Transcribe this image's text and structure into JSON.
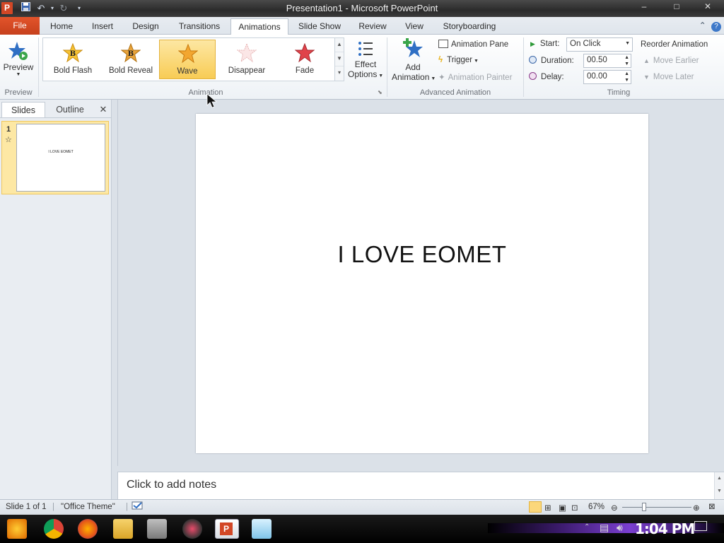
{
  "window": {
    "title": "Presentation1 - Microsoft PowerPoint",
    "app_icon_letter": "P",
    "min": "–",
    "max": "□",
    "close": "✕"
  },
  "ribbon_tabs": [
    "File",
    "Home",
    "Insert",
    "Design",
    "Transitions",
    "Animations",
    "Slide Show",
    "Review",
    "View",
    "Storyboarding"
  ],
  "active_tab": "Animations",
  "ribbon": {
    "preview": {
      "label": "Preview",
      "group": "Preview"
    },
    "animation_gallery": [
      {
        "label": "Bold Flash",
        "color": "#f5c232"
      },
      {
        "label": "Bold Reveal",
        "color": "#e8a33a"
      },
      {
        "label": "Wave",
        "color": "#f2a630",
        "selected": true
      },
      {
        "label": "Disappear",
        "color": "#f2c6c6"
      },
      {
        "label": "Fade",
        "color": "#e0434a"
      }
    ],
    "effect_options": {
      "line1": "Effect",
      "line2": "Options"
    },
    "animation_group_label": "Animation",
    "add_animation": {
      "line1": "Add",
      "line2": "Animation"
    },
    "animation_pane": "Animation Pane",
    "trigger": "Trigger",
    "animation_painter": "Animation Painter",
    "advanced_group_label": "Advanced Animation",
    "timing": {
      "start_label": "Start:",
      "start_value": "On Click",
      "duration_label": "Duration:",
      "duration_value": "00.50",
      "delay_label": "Delay:",
      "delay_value": "00.00",
      "group_label": "Timing"
    },
    "reorder": {
      "title": "Reorder Animation",
      "earlier": "Move Earlier",
      "later": "Move Later"
    }
  },
  "left_pane": {
    "tabs": [
      "Slides",
      "Outline"
    ],
    "active": "Slides",
    "close": "✕",
    "slide_number": "1",
    "anim_marker": "☆",
    "thumb_text": "I LOVE EOMET"
  },
  "slide": {
    "text": "I LOVE EOMET"
  },
  "notes": {
    "placeholder": "Click to add notes"
  },
  "status": {
    "slide": "Slide 1 of 1",
    "theme": "\"Office Theme\"",
    "zoom": "67%"
  },
  "taskbar": {
    "time": "1:04 PM"
  }
}
